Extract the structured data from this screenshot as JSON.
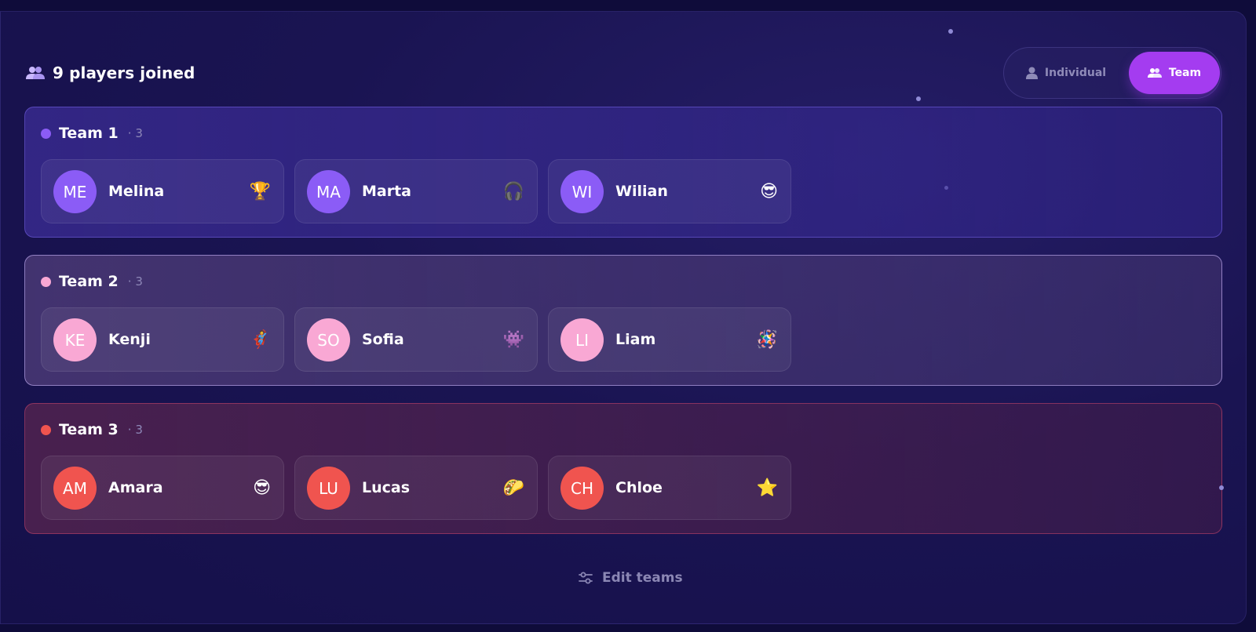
{
  "header": {
    "players_joined": "9 players joined",
    "players_icon": "users-icon"
  },
  "mode_toggle": {
    "individual_label": "Individual",
    "individual_icon": "user-icon",
    "team_label": "Team",
    "team_icon": "users-icon",
    "selected": "Team",
    "active_color": "#a43cf0"
  },
  "teams": [
    {
      "name": "Team 1",
      "count": "· 3",
      "color": "#8b5cf6",
      "players": [
        {
          "initials": "ME",
          "name": "Melina",
          "emoji": "🏆"
        },
        {
          "initials": "MA",
          "name": "Marta",
          "emoji": "🎧"
        },
        {
          "initials": "WI",
          "name": "Wilian",
          "emoji": "😎"
        }
      ]
    },
    {
      "name": "Team 2",
      "count": "· 3",
      "color": "#f9a8d4",
      "players": [
        {
          "initials": "KE",
          "name": "Kenji",
          "emoji": "🦸"
        },
        {
          "initials": "SO",
          "name": "Sofia",
          "emoji": "👾"
        },
        {
          "initials": "LI",
          "name": "Liam",
          "emoji": "🪅"
        }
      ]
    },
    {
      "name": "Team 3",
      "count": "· 3",
      "color": "#f0544f",
      "players": [
        {
          "initials": "AM",
          "name": "Amara",
          "emoji": "😎"
        },
        {
          "initials": "LU",
          "name": "Lucas",
          "emoji": "🌮"
        },
        {
          "initials": "CH",
          "name": "Chloe",
          "emoji": "⭐"
        }
      ]
    }
  ],
  "footer": {
    "edit_teams_label": "Edit teams",
    "edit_teams_icon": "sliders-icon"
  }
}
